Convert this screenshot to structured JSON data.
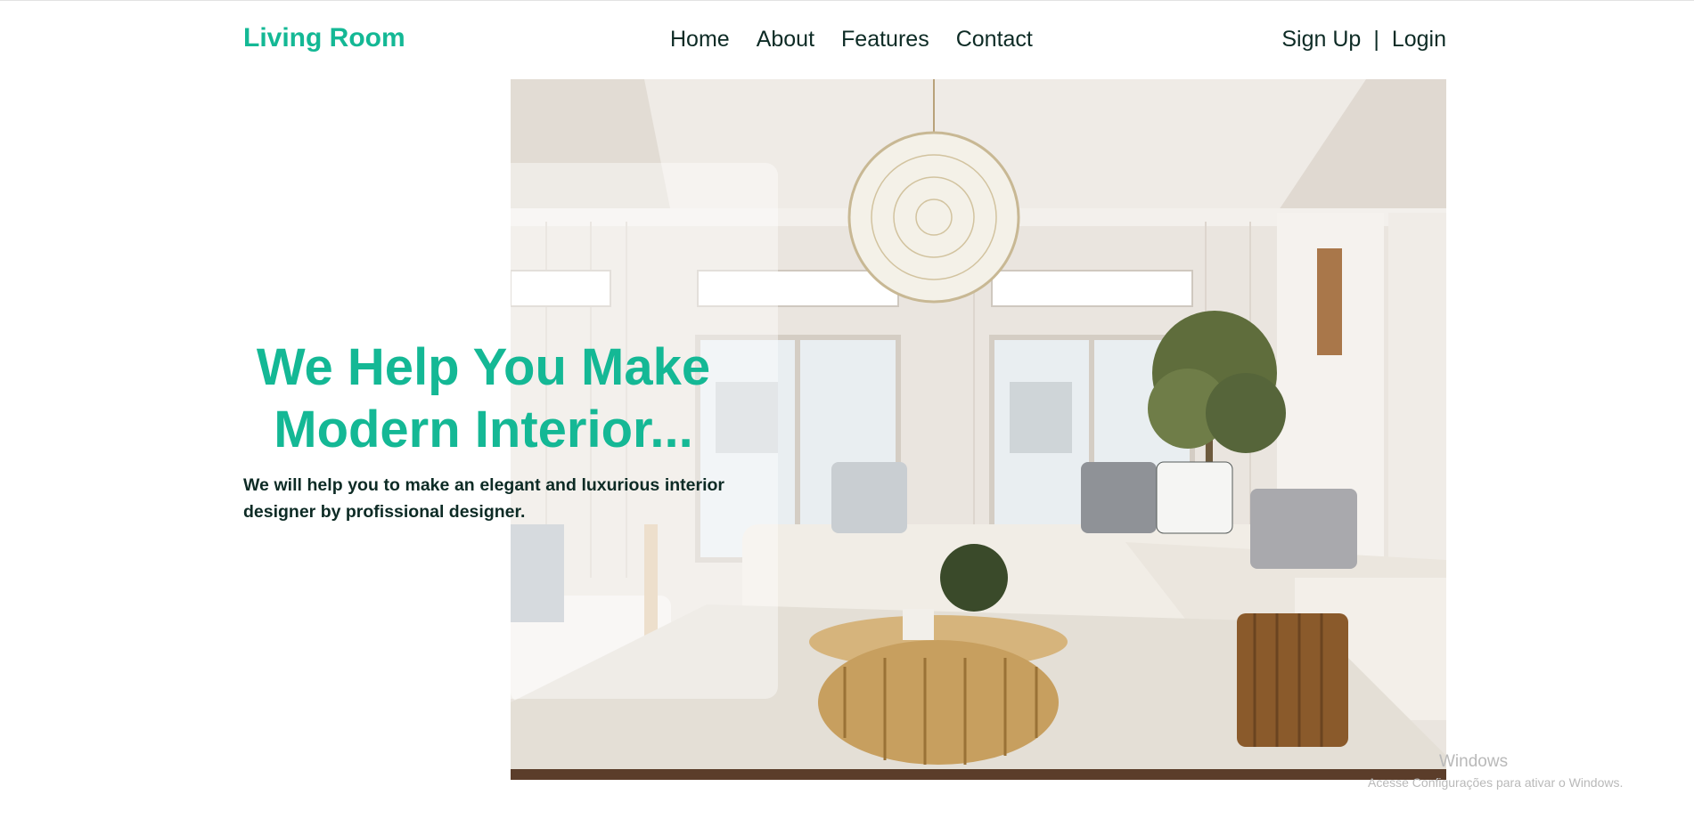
{
  "header": {
    "logo": "Living Room",
    "nav": [
      "Home",
      "About",
      "Features",
      "Contact"
    ],
    "auth": {
      "signup": "Sign Up",
      "separator": "|",
      "login": "Login"
    }
  },
  "hero": {
    "headline_line1": "We Help You Make",
    "headline_line2": "Modern Interior...",
    "subtext": "We will help you to make an elegant and luxurious interior designer by profissional designer."
  },
  "watermark": {
    "line1": "Windows",
    "line2": "Acesse Configurações para ativar o Windows."
  },
  "colors": {
    "accent": "#14b895",
    "text": "#0d2b25",
    "background": "#ffffff"
  }
}
